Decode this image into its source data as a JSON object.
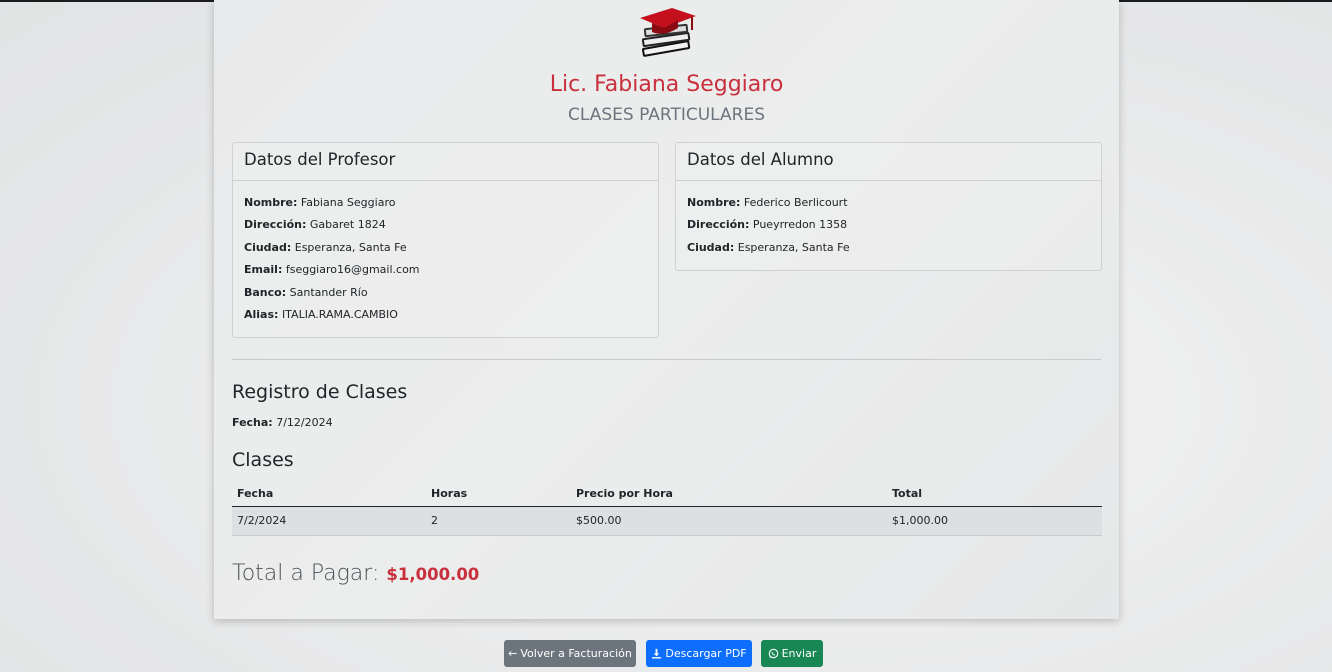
{
  "header": {
    "title": "Lic. Fabiana Seggiaro",
    "subtitle": "CLASES PARTICULARES",
    "logo_icon": "graduation-cap-books-icon"
  },
  "profesor": {
    "heading": "Datos del Profesor",
    "fields": [
      {
        "label": "Nombre:",
        "value": "Fabiana Seggiaro"
      },
      {
        "label": "Dirección:",
        "value": "Gabaret 1824"
      },
      {
        "label": "Ciudad:",
        "value": "Esperanza, Santa Fe"
      },
      {
        "label": "Email:",
        "value": "fseggiaro16@gmail.com"
      },
      {
        "label": "Banco:",
        "value": "Santander Río"
      },
      {
        "label": "Alias:",
        "value": "ITALIA.RAMA.CAMBIO"
      }
    ]
  },
  "alumno": {
    "heading": "Datos del Alumno",
    "fields": [
      {
        "label": "Nombre:",
        "value": "Federico Berlicourt"
      },
      {
        "label": "Dirección:",
        "value": "Pueyrredon 1358"
      },
      {
        "label": "Ciudad:",
        "value": "Esperanza, Santa Fe"
      }
    ]
  },
  "registro": {
    "heading": "Registro de Clases",
    "fecha_label": "Fecha:",
    "fecha_value": "7/12/2024"
  },
  "clases": {
    "heading": "Clases",
    "columns": [
      "Fecha",
      "Horas",
      "Precio por Hora",
      "Total"
    ],
    "rows": [
      [
        "7/2/2024",
        "2",
        "$500.00",
        "$1,000.00"
      ]
    ]
  },
  "total": {
    "label": "Total a Pagar:",
    "value": "$1,000.00"
  },
  "actions": {
    "back_label": "Volver a Facturación",
    "back_icon": "arrow-left-icon",
    "pdf_label": "Descargar PDF",
    "pdf_icon": "download-icon",
    "send_label": "Enviar",
    "send_icon": "whatsapp-icon"
  },
  "colors": {
    "accent": "#c9303d",
    "back_button": "#6c757d",
    "pdf_button": "#0d6efd",
    "send_button": "#198754"
  }
}
